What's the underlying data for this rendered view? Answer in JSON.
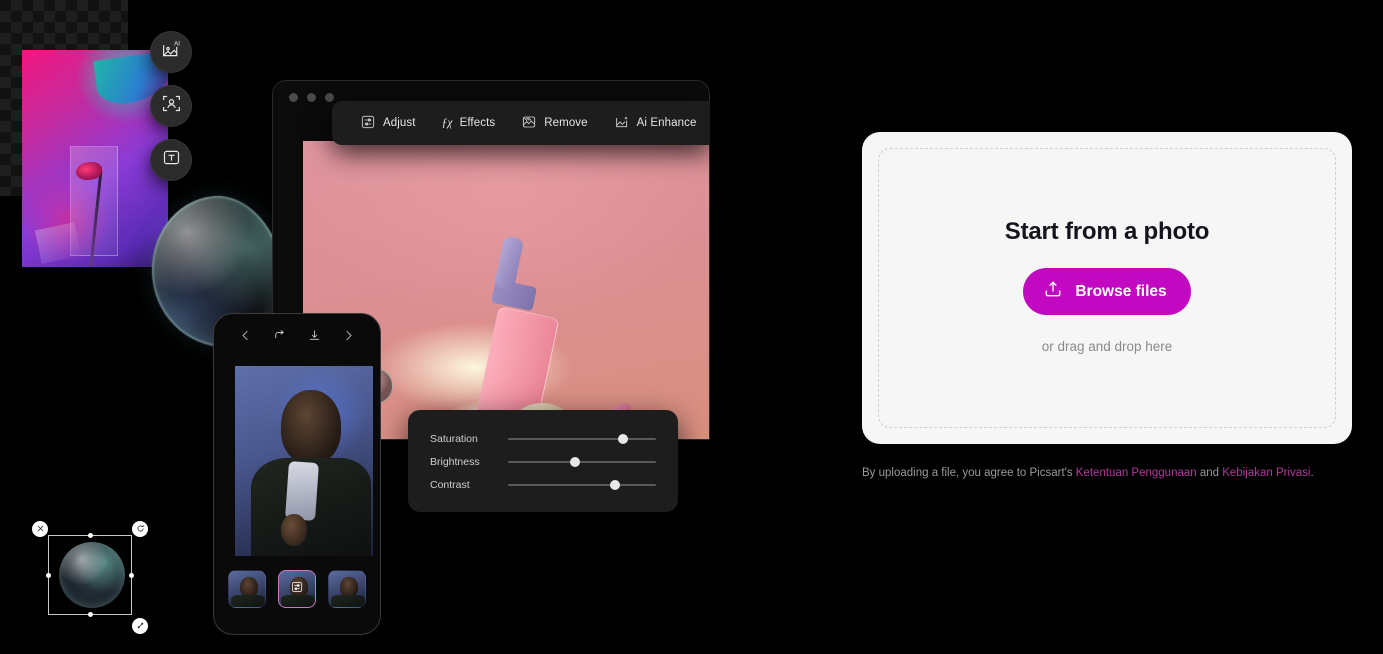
{
  "upload_card": {
    "title": "Start from a photo",
    "browse_label": "Browse files",
    "browse_icon": "upload-icon",
    "drag_hint": "or drag and drop here",
    "accent_color": "#C209C1",
    "card_background": "#F6F6F6",
    "title_color": "#14141E"
  },
  "legal": {
    "prefix": "By uploading a file, you agree to Picsart's ",
    "terms_link": "Ketentuan Penggunaan",
    "conjunction": " and ",
    "privacy_link": "Kebijakan Privasi",
    "suffix": ".",
    "link_color": "#B0399E",
    "text_color": "#9A9A9A"
  },
  "editor_mockup": {
    "window_dots": 3,
    "toolbar": [
      {
        "label": "Adjust",
        "icon": "adjust-sliders-icon"
      },
      {
        "label": "Effects",
        "icon": "fx-icon"
      },
      {
        "label": "Remove",
        "icon": "remove-background-icon"
      },
      {
        "label": "Ai Enhance",
        "icon": "ai-enhance-icon"
      }
    ],
    "sliders": [
      {
        "label": "Saturation",
        "value": 78
      },
      {
        "label": "Brightness",
        "value": 45
      },
      {
        "label": "Contrast",
        "value": 72
      }
    ]
  },
  "side_tools": [
    {
      "icon": "ai-image-icon",
      "name": "ai-image-tool"
    },
    {
      "icon": "person-select-icon",
      "name": "person-select-tool"
    },
    {
      "icon": "text-tool-icon",
      "name": "text-tool"
    }
  ],
  "phone_mockup": {
    "nav": [
      {
        "icon": "chevron-left-icon",
        "name": "back"
      },
      {
        "icon": "redo-arrow-icon",
        "name": "redo"
      },
      {
        "icon": "download-icon",
        "name": "download"
      },
      {
        "icon": "chevron-right-icon",
        "name": "forward"
      }
    ],
    "thumbnails": [
      {
        "selected": false
      },
      {
        "selected": true,
        "overlay_icon": "adjust-sliders-icon"
      },
      {
        "selected": false
      }
    ]
  },
  "selection_widget": {
    "handles": [
      {
        "icon": "close-icon",
        "position": "top-left"
      },
      {
        "icon": "rotate-icon",
        "position": "top-right"
      },
      {
        "icon": "resize-icon",
        "position": "bottom-right"
      }
    ]
  }
}
